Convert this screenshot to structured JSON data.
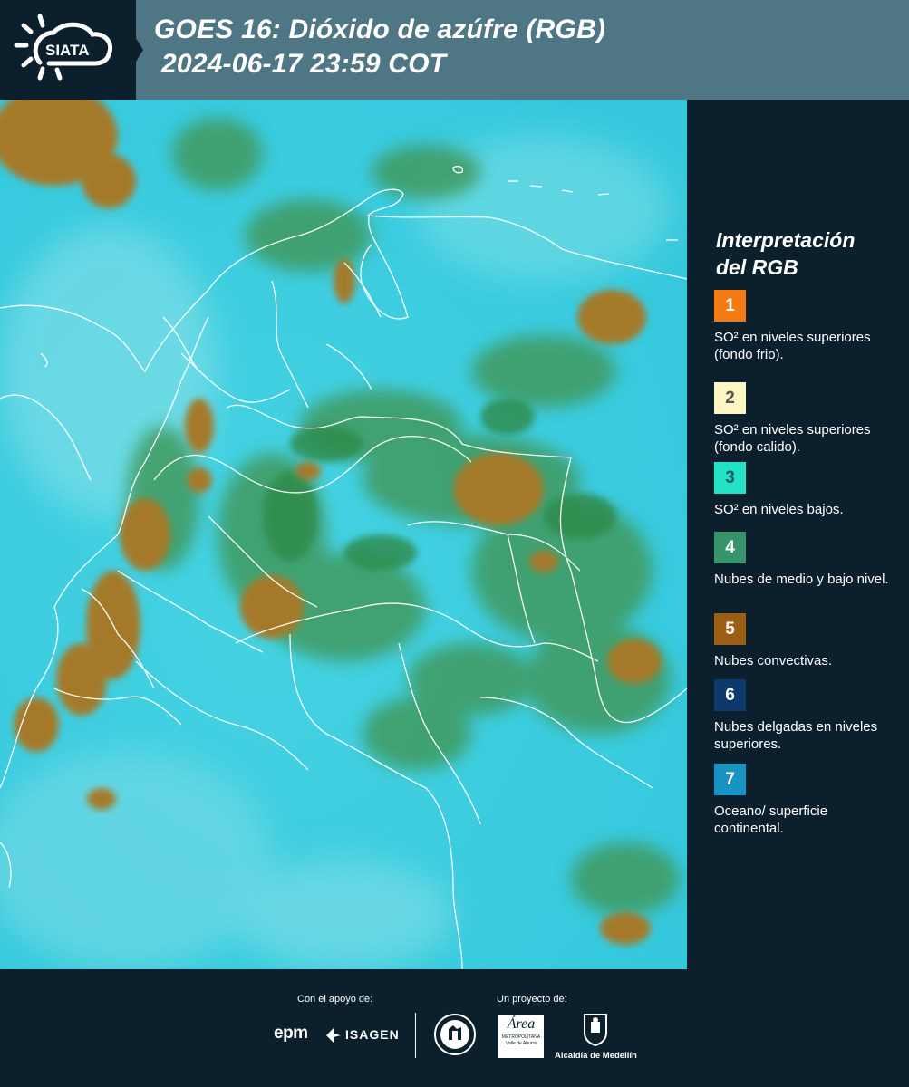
{
  "header": {
    "logo_text": "SIATA",
    "title_line1": "GOES 16: Dióxido de azúfre (RGB)",
    "title_line2": "2024-06-17 23:59 COT"
  },
  "legend": {
    "title_line1": "Interpretación",
    "title_line2": "del RGB",
    "items": [
      {
        "number": "1",
        "color": "#f47b12",
        "number_color": "#ffffff",
        "text": "SO² en niveles superiores (fondo frio)."
      },
      {
        "number": "2",
        "color": "#fef6c2",
        "number_color": "#555555",
        "text": "SO² en niveles superiores (fondo calido)."
      },
      {
        "number": "3",
        "color": "#20e3c8",
        "number_color": "#1b5a5a",
        "text": "SO² en niveles bajos."
      },
      {
        "number": "4",
        "color": "#37936a",
        "number_color": "#ffffff",
        "text": "Nubes de medio y bajo nivel."
      },
      {
        "number": "5",
        "color": "#9b5e14",
        "number_color": "#ffffff",
        "text": "Nubes convectivas."
      },
      {
        "number": "6",
        "color": "#0e3a6b",
        "number_color": "#ffffff",
        "text": "Nubes delgadas en niveles superiores."
      },
      {
        "number": "7",
        "color": "#1794c4",
        "number_color": "#ffffff",
        "text": "Oceano/ superficie continental."
      }
    ]
  },
  "footer": {
    "support_label": "Con el apoyo de:",
    "project_label": "Un proyecto de:",
    "logos": {
      "epm": "epm",
      "isagen": "ISAGEN",
      "area_name": "Área",
      "area_sub1": "METROPOLITANA",
      "area_sub2": "Valle de Aburrá",
      "alcaldia": "Alcaldía de Medellín"
    }
  }
}
